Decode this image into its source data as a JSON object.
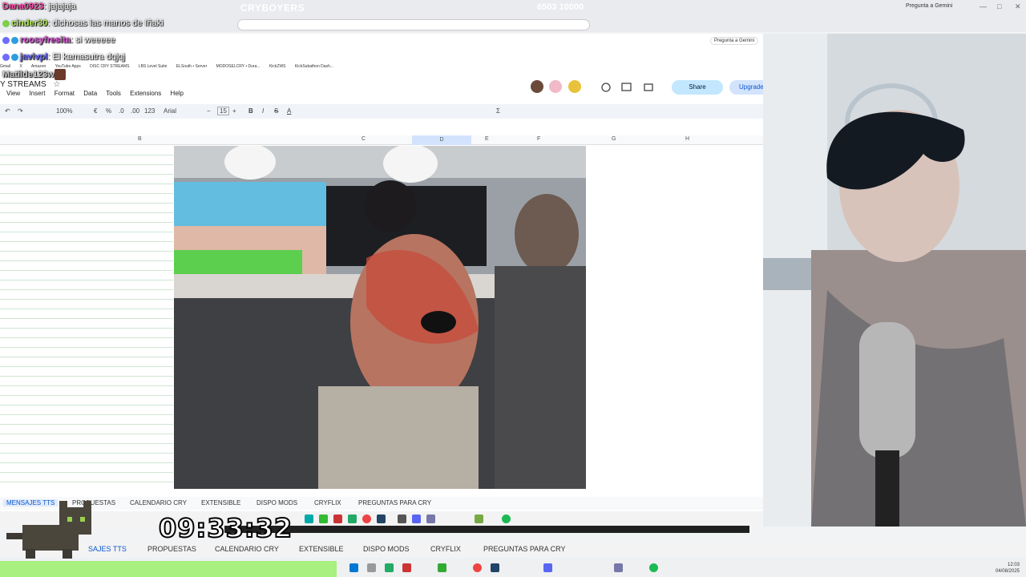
{
  "browser": {
    "window_title": "CRYBOYERS",
    "counter": "6503 10000",
    "gemini_label": "Pregunta a Gemini",
    "gemini_label_inner": "Pregunta a Gemini"
  },
  "chat": [
    {
      "user": "Dana0923",
      "msg": ": jajajaja"
    },
    {
      "user": "cinder30",
      "msg": ": dichosas las manos de Iñaki"
    },
    {
      "user": "roosyfresita",
      "msg": ": si weeeee"
    },
    {
      "user": "javivpl",
      "msg": ": El kamasutra dqjqj"
    },
    {
      "user": "Matilde123w",
      "msg": ""
    }
  ],
  "bookmarks": [
    "Gmail",
    "X",
    "Amazon",
    "YouTube Apps",
    "DISC CRY STREAMS",
    "LBS Level Suite",
    "ELSouth • Server",
    "MODOSELCRY • Dura...",
    "KickZWS",
    "KickSubathon Dash..."
  ],
  "sheet": {
    "title": "Y STREAMS",
    "menu": [
      "View",
      "Insert",
      "Format",
      "Data",
      "Tools",
      "Extensions",
      "Help"
    ],
    "share_label": "Share",
    "upgrade_label": "Upgrade",
    "toolbar": {
      "zoom": "100%",
      "currency": "€",
      "percent": "%",
      "dec_less": ".0",
      "dec_more": ".00",
      "numfmt": "123",
      "font": "Arial",
      "font_size": "15",
      "bold": "B",
      "italic": "I",
      "strike": "S",
      "text_color": "A",
      "sum": "Σ"
    },
    "columns": [
      "B",
      "C",
      "D",
      "E",
      "F",
      "G",
      "H"
    ],
    "selected_column": "D",
    "tabs": [
      "MENSAJES TTS",
      "PROPUESTAS",
      "CALENDARIO CRY",
      "EXTENSIBLE",
      "DISPO MODS",
      "CRYFLIX",
      "PREGUNTAS PARA CRY"
    ],
    "active_tab": "MENSAJES TTS"
  },
  "bottom_tabs": [
    "SAJES TTS",
    "PROPUESTAS",
    "CALENDARIO CRY",
    "EXTENSIBLE",
    "DISPO MODS",
    "CRYFLIX",
    "PREGUNTAS PARA CRY"
  ],
  "timer": "09:33:32",
  "tray": {
    "time": "12:03",
    "date": "04/08/2025"
  },
  "colors": {
    "accent": "#0b57d0",
    "share": "#c2e7ff",
    "green_bar": "#a8f080",
    "grid_line": "#cfe6d4"
  }
}
